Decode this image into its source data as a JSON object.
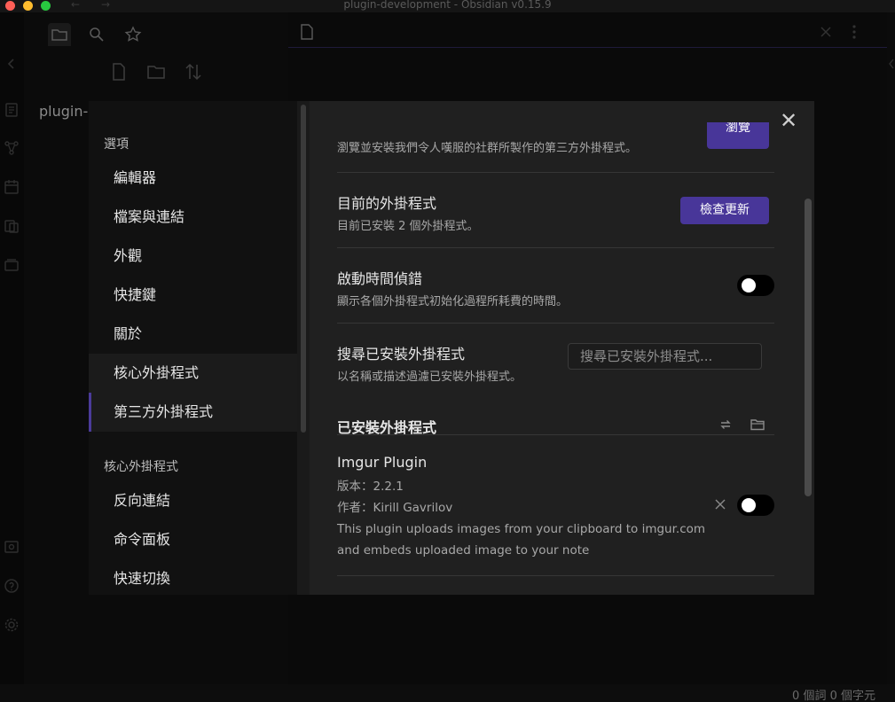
{
  "window": {
    "title": "plugin-development - Obsidian v0.15.9",
    "nav_back": "←",
    "nav_forward": "→"
  },
  "file_pane": {
    "vault_name": "plugin-development"
  },
  "status_bar": {
    "text": "0 個詞  0 個字元"
  },
  "settings": {
    "sidebar": {
      "options_heading": "選項",
      "options_items": [
        "編輯器",
        "檔案與連結",
        "外觀",
        "快捷鍵",
        "關於",
        "核心外掛程式",
        "第三方外掛程式"
      ],
      "core_heading": "核心外掛程式",
      "core_items": [
        "反向連結",
        "命令面板",
        "快速切換"
      ]
    },
    "community": {
      "browse_desc": "瀏覽並安裝我們令人嘆服的社群所製作的第三方外掛程式。",
      "browse_button": "瀏覽"
    },
    "installed": {
      "name": "目前的外掛程式",
      "desc": "目前已安裝 2 個外掛程式。",
      "check_button": "檢查更新"
    },
    "debug": {
      "name": "啟動時間偵錯",
      "desc": "顯示各個外掛程式初始化過程所耗費的時間。",
      "enabled": false
    },
    "search": {
      "name": "搜尋已安裝外掛程式",
      "desc": "以名稱或描述過濾已安裝外掛程式。",
      "placeholder": "搜尋已安裝外掛程式..."
    },
    "installed_heading": "已安裝外掛程式",
    "plugins": [
      {
        "name": "Imgur Plugin",
        "version": "版本：2.2.1",
        "author": "作者：Kirill Gavrilov",
        "desc_line1": "This plugin uploads images from your clipboard to imgur.com",
        "desc_line2": "and embeds uploaded image to your note",
        "enabled": false
      }
    ],
    "close_symbol": "✕"
  },
  "colors": {
    "accent": "#483699",
    "active_marker": "#4b3b9a"
  }
}
